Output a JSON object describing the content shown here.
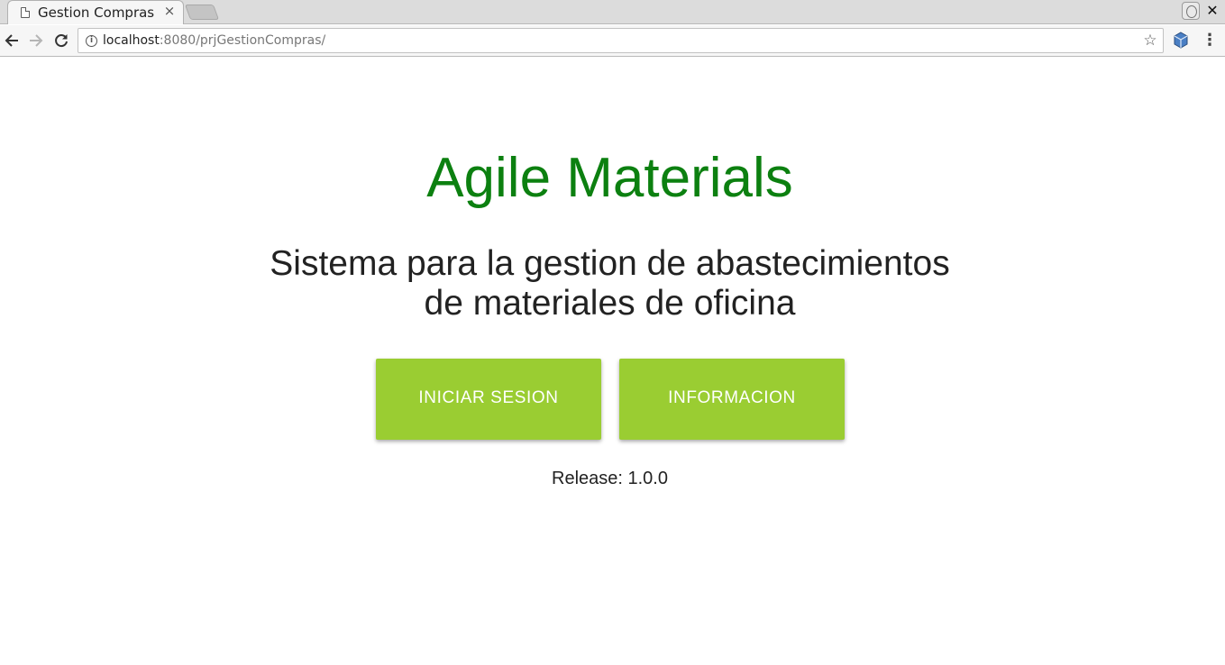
{
  "browser": {
    "tab": {
      "title": "Gestion Compras",
      "close_glyph": "×"
    },
    "window_close_glyph": "✕",
    "address": {
      "host": "localhost",
      "rest": ":8080/prjGestionCompras/"
    },
    "icons": [
      "page-icon",
      "new-tab",
      "profile-icon",
      "back-arrow-icon",
      "forward-arrow-icon",
      "reload-icon",
      "info-icon",
      "star-icon",
      "extension-cube-icon",
      "menu-dots-icon"
    ]
  },
  "page": {
    "title": "Agile Materials",
    "subtitle_line1": "Sistema para la gestion de abastecimientos",
    "subtitle_line2": "de materiales de oficina",
    "buttons": {
      "login": "INICIAR SESION",
      "info": "INFORMACION"
    },
    "release": "Release: 1.0.0"
  },
  "colors": {
    "title": "#0c8010",
    "button_bg": "#9acd32",
    "button_text": "#ffffff"
  }
}
